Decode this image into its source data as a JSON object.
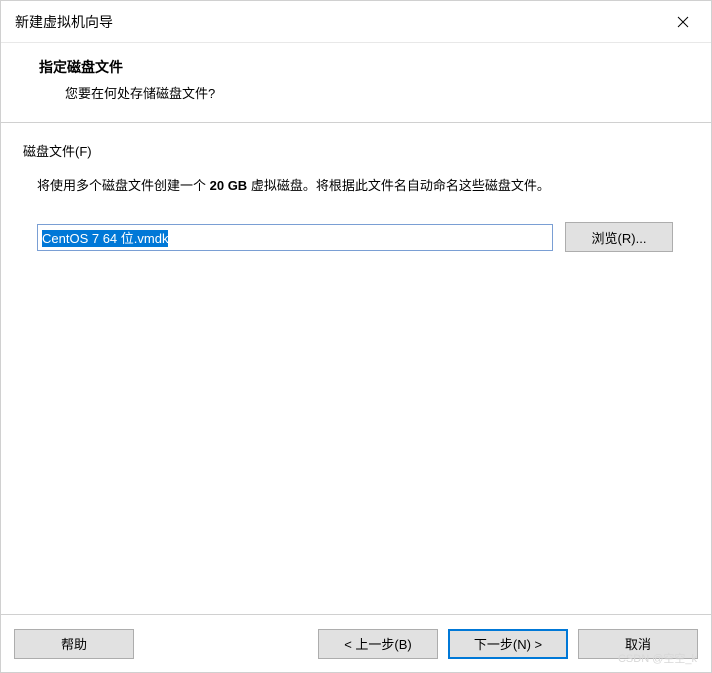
{
  "titlebar": {
    "title": "新建虚拟机向导"
  },
  "header": {
    "title": "指定磁盘文件",
    "subtitle": "您要在何处存储磁盘文件?"
  },
  "content": {
    "section_label": "磁盘文件(F)",
    "description_pre": "将使用多个磁盘文件创建一个 ",
    "description_bold": "20 GB",
    "description_post": " 虚拟磁盘。将根据此文件名自动命名这些磁盘文件。",
    "file_value": "CentOS 7 64 位.vmdk",
    "browse_label": "浏览(R)..."
  },
  "footer": {
    "help_label": "帮助",
    "back_label": "< 上一步(B)",
    "next_label": "下一步(N) >",
    "cancel_label": "取消"
  },
  "watermark": "CSDN @空空_k"
}
